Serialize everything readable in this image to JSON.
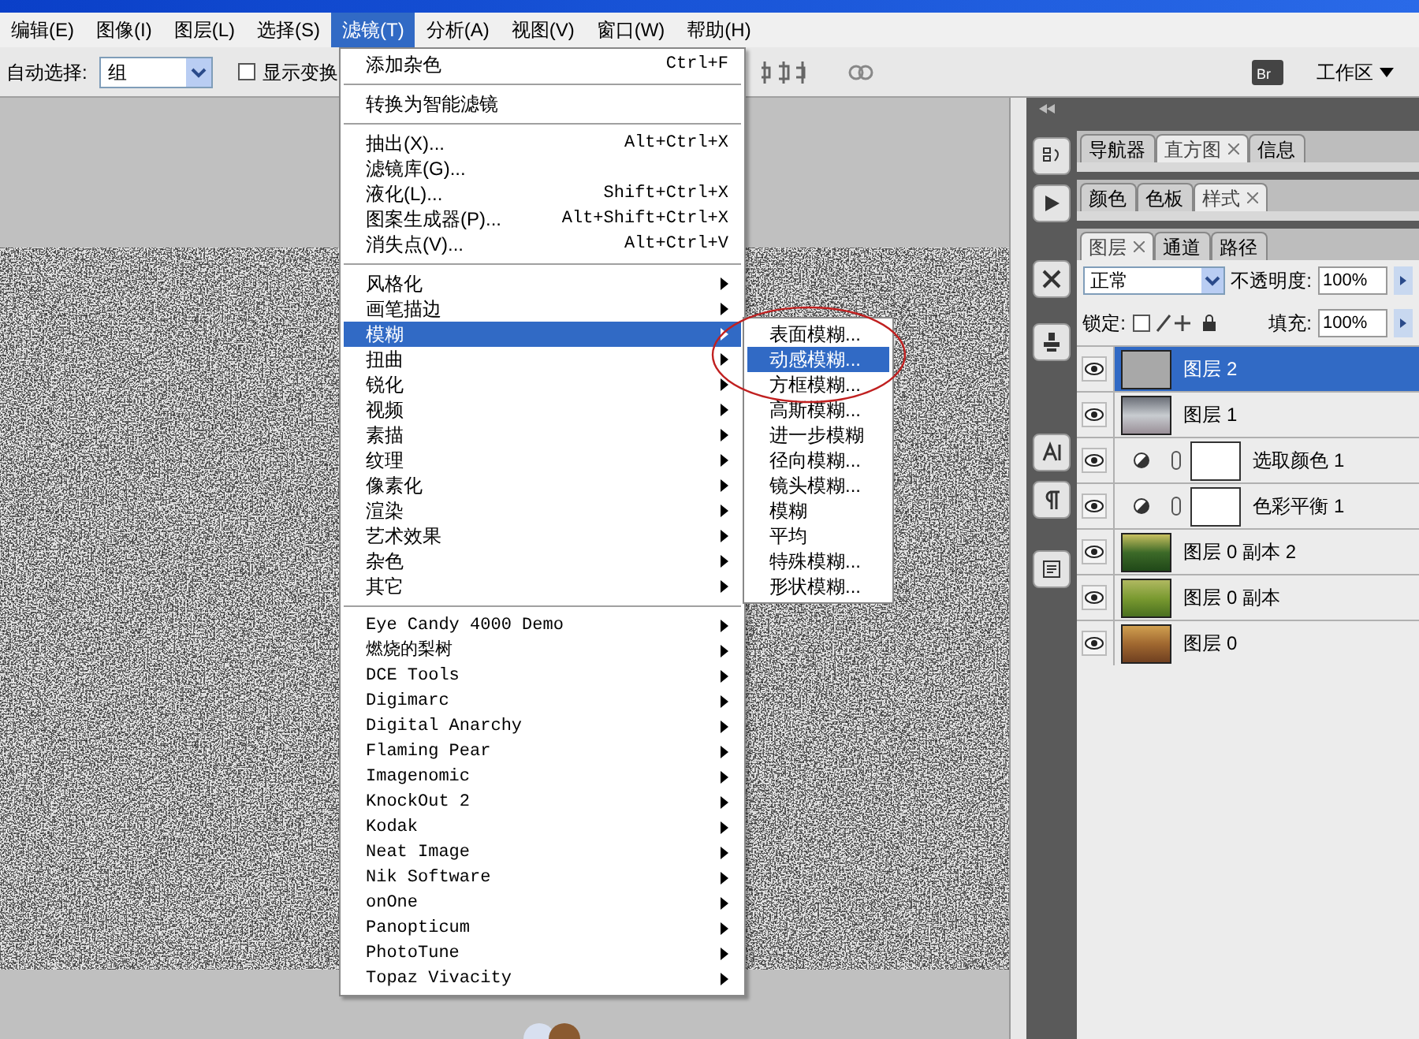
{
  "menubar": [
    {
      "label": "编辑(E)",
      "selected": false
    },
    {
      "label": "图像(I)",
      "selected": false
    },
    {
      "label": "图层(L)",
      "selected": false
    },
    {
      "label": "选择(S)",
      "selected": false
    },
    {
      "label": "滤镜(T)",
      "selected": true
    },
    {
      "label": "分析(A)",
      "selected": false
    },
    {
      "label": "视图(V)",
      "selected": false
    },
    {
      "label": "窗口(W)",
      "selected": false
    },
    {
      "label": "帮助(H)",
      "selected": false
    }
  ],
  "options_bar": {
    "auto_select_label": "自动选择:",
    "auto_select_value": "组",
    "show_transform_label": "显示变换",
    "bridge_label": "Br",
    "show_transform_checked": false,
    "workspace_label": "工作区"
  },
  "filter_menu": {
    "sections": [
      {
        "items": [
          {
            "label": "添加杂色",
            "shortcut": "Ctrl+F",
            "submenu": false,
            "selected": false
          }
        ]
      },
      {
        "items": [
          {
            "label": "转换为智能滤镜",
            "submenu": false,
            "selected": false
          }
        ]
      },
      {
        "items": [
          {
            "label": "抽出(X)...",
            "shortcut": "Alt+Ctrl+X",
            "submenu": false,
            "selected": false
          },
          {
            "label": "滤镜库(G)...",
            "submenu": false,
            "selected": false
          },
          {
            "label": "液化(L)...",
            "shortcut": "Shift+Ctrl+X",
            "submenu": false,
            "selected": false
          },
          {
            "label": "图案生成器(P)...",
            "shortcut": "Alt+Shift+Ctrl+X",
            "submenu": false,
            "selected": false
          },
          {
            "label": "消失点(V)...",
            "shortcut": "Alt+Ctrl+V",
            "submenu": false,
            "selected": false
          }
        ]
      },
      {
        "items": [
          {
            "label": "风格化",
            "submenu": true,
            "selected": false
          },
          {
            "label": "画笔描边",
            "submenu": true,
            "selected": false
          },
          {
            "label": "模糊",
            "submenu": true,
            "selected": true
          },
          {
            "label": "扭曲",
            "submenu": true,
            "selected": false
          },
          {
            "label": "锐化",
            "submenu": true,
            "selected": false
          },
          {
            "label": "视频",
            "submenu": true,
            "selected": false
          },
          {
            "label": "素描",
            "submenu": true,
            "selected": false
          },
          {
            "label": "纹理",
            "submenu": true,
            "selected": false
          },
          {
            "label": "像素化",
            "submenu": true,
            "selected": false
          },
          {
            "label": "渲染",
            "submenu": true,
            "selected": false
          },
          {
            "label": "艺术效果",
            "submenu": true,
            "selected": false
          },
          {
            "label": "杂色",
            "submenu": true,
            "selected": false
          },
          {
            "label": "其它",
            "submenu": true,
            "selected": false
          }
        ]
      },
      {
        "items": [
          {
            "label": "Eye Candy 4000 Demo",
            "submenu": true,
            "selected": false
          },
          {
            "label": "燃烧的梨树",
            "submenu": true,
            "selected": false
          },
          {
            "label": "DCE Tools",
            "submenu": true,
            "selected": false
          },
          {
            "label": "Digimarc",
            "submenu": true,
            "selected": false
          },
          {
            "label": "Digital Anarchy",
            "submenu": true,
            "selected": false
          },
          {
            "label": "Flaming Pear",
            "submenu": true,
            "selected": false
          },
          {
            "label": "Imagenomic",
            "submenu": true,
            "selected": false
          },
          {
            "label": "KnockOut 2",
            "submenu": true,
            "selected": false
          },
          {
            "label": "Kodak",
            "submenu": true,
            "selected": false
          },
          {
            "label": "Neat Image",
            "submenu": true,
            "selected": false
          },
          {
            "label": "Nik Software",
            "submenu": true,
            "selected": false
          },
          {
            "label": "onOne",
            "submenu": true,
            "selected": false
          },
          {
            "label": "Panopticum",
            "submenu": true,
            "selected": false
          },
          {
            "label": "PhotoTune",
            "submenu": true,
            "selected": false
          },
          {
            "label": "Topaz Vivacity",
            "submenu": true,
            "selected": false
          }
        ]
      }
    ]
  },
  "blur_submenu": {
    "items": [
      {
        "label": "表面模糊...",
        "selected": false
      },
      {
        "label": "动感模糊...",
        "selected": true
      },
      {
        "label": "方框模糊...",
        "selected": false
      },
      {
        "label": "高斯模糊...",
        "selected": false
      },
      {
        "label": "进一步模糊",
        "selected": false
      },
      {
        "label": "径向模糊...",
        "selected": false
      },
      {
        "label": "镜头模糊...",
        "selected": false
      },
      {
        "label": "模糊",
        "selected": false
      },
      {
        "label": "平均",
        "selected": false
      },
      {
        "label": "特殊模糊...",
        "selected": false
      },
      {
        "label": "形状模糊...",
        "selected": false
      }
    ]
  },
  "panel_groups": [
    {
      "tabs": [
        {
          "label": "导航器",
          "selected": false
        },
        {
          "label": "直方图",
          "selected": true
        },
        {
          "label": "信息",
          "selected": false
        }
      ]
    },
    {
      "tabs": [
        {
          "label": "颜色",
          "selected": false
        },
        {
          "label": "色板",
          "selected": false
        },
        {
          "label": "样式",
          "selected": true
        }
      ]
    },
    {
      "tabs": [
        {
          "label": "图层",
          "selected": true
        },
        {
          "label": "通道",
          "selected": false
        },
        {
          "label": "路径",
          "selected": false
        }
      ]
    }
  ],
  "layers_panel": {
    "blend_mode": "正常",
    "opacity_label": "不透明度:",
    "opacity": "100%",
    "lock_label": "锁定:",
    "fill_label": "填充:",
    "fill": "100%",
    "layers": [
      {
        "name": "图层 2",
        "kind": "pixel",
        "visible": true,
        "selected": true
      },
      {
        "name": "图层 1",
        "kind": "pixel",
        "visible": true,
        "selected": false
      },
      {
        "name": "选取颜色 1",
        "kind": "adjustment",
        "visible": true,
        "selected": false
      },
      {
        "name": "色彩平衡 1",
        "kind": "adjustment",
        "visible": true,
        "selected": false
      },
      {
        "name": "图层 0 副本 2",
        "kind": "pixel",
        "visible": true,
        "selected": false
      },
      {
        "name": "图层 0 副本",
        "kind": "pixel",
        "visible": true,
        "selected": false
      },
      {
        "name": "图层 0",
        "kind": "pixel",
        "visible": true,
        "selected": false
      }
    ]
  }
}
